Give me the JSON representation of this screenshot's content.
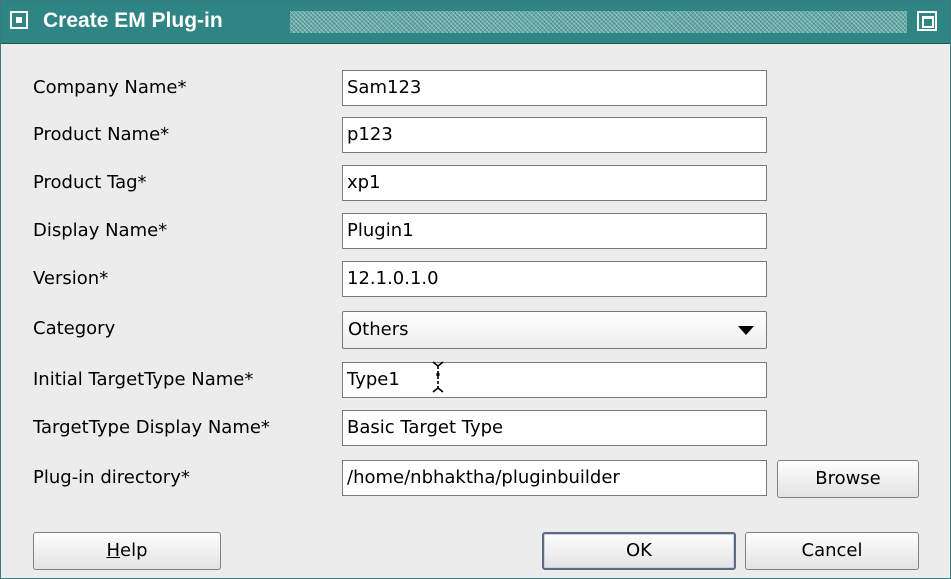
{
  "window": {
    "title": "Create EM Plug-in"
  },
  "form": {
    "company_name": {
      "label": "Company Name*",
      "value": "Sam123"
    },
    "product_name": {
      "label": "Product Name*",
      "value": "p123"
    },
    "product_tag": {
      "label": "Product Tag*",
      "value": "xp1"
    },
    "display_name": {
      "label": "Display Name*",
      "value": "Plugin1"
    },
    "version": {
      "label": "Version*",
      "value": "12.1.0.1.0"
    },
    "category": {
      "label": "Category",
      "value": "Others"
    },
    "initial_target_type_name": {
      "label": "Initial TargetType Name*",
      "value": "Type1"
    },
    "target_type_display_name": {
      "label": "TargetType Display Name*",
      "value": "Basic Target Type"
    },
    "plugin_directory": {
      "label": "Plug-in directory*",
      "value": "/home/nbhaktha/pluginbuilder"
    }
  },
  "buttons": {
    "browse": "Browse",
    "help": "Help",
    "ok": "OK",
    "cancel": "Cancel"
  },
  "colors": {
    "titlebar": "#2e8583",
    "dialog_background": "#ececec"
  },
  "icons": {
    "system_menu": "window-menu-icon",
    "maximize": "maximize-icon",
    "dropdown": "chevron-down-icon",
    "cursor": "text-cursor-icon"
  }
}
